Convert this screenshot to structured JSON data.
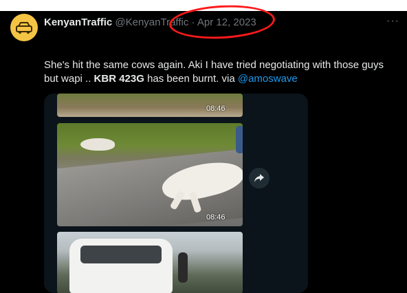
{
  "tweet": {
    "author_name": "KenyanTraffic",
    "handle": "@KenyanTraffic",
    "separator": "·",
    "date": "Apr 12, 2023",
    "more_glyph": "···",
    "text_line1": "She's hit the same cows again.  Aki  I have tried negotiating with those guys",
    "text_pre_bold": "but wapi .. ",
    "text_bold": "KBR 423G",
    "text_post_bold": " has been burnt. via ",
    "mention": "@amoswave"
  },
  "media": {
    "timestamps": [
      "08:46",
      "08:46"
    ],
    "share_icon": "share-arrow-icon"
  },
  "colors": {
    "background": "#000000",
    "text": "#e7e9ea",
    "muted": "#71767b",
    "link": "#1d9bf0",
    "annotation": "#ff1a1a",
    "avatar": "#f6c445"
  }
}
